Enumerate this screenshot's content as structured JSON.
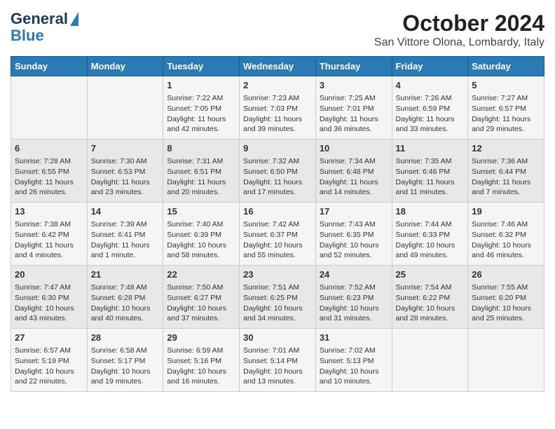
{
  "logo": {
    "line1": "General",
    "line2": "Blue"
  },
  "title": "October 2024",
  "subtitle": "San Vittore Olona, Lombardy, Italy",
  "headers": [
    "Sunday",
    "Monday",
    "Tuesday",
    "Wednesday",
    "Thursday",
    "Friday",
    "Saturday"
  ],
  "weeks": [
    [
      {
        "day": "",
        "content": ""
      },
      {
        "day": "",
        "content": ""
      },
      {
        "day": "1",
        "content": "Sunrise: 7:22 AM\nSunset: 7:05 PM\nDaylight: 11 hours and 42 minutes."
      },
      {
        "day": "2",
        "content": "Sunrise: 7:23 AM\nSunset: 7:03 PM\nDaylight: 11 hours and 39 minutes."
      },
      {
        "day": "3",
        "content": "Sunrise: 7:25 AM\nSunset: 7:01 PM\nDaylight: 11 hours and 36 minutes."
      },
      {
        "day": "4",
        "content": "Sunrise: 7:26 AM\nSunset: 6:59 PM\nDaylight: 11 hours and 33 minutes."
      },
      {
        "day": "5",
        "content": "Sunrise: 7:27 AM\nSunset: 6:57 PM\nDaylight: 11 hours and 29 minutes."
      }
    ],
    [
      {
        "day": "6",
        "content": "Sunrise: 7:28 AM\nSunset: 6:55 PM\nDaylight: 11 hours and 26 minutes."
      },
      {
        "day": "7",
        "content": "Sunrise: 7:30 AM\nSunset: 6:53 PM\nDaylight: 11 hours and 23 minutes."
      },
      {
        "day": "8",
        "content": "Sunrise: 7:31 AM\nSunset: 6:51 PM\nDaylight: 11 hours and 20 minutes."
      },
      {
        "day": "9",
        "content": "Sunrise: 7:32 AM\nSunset: 6:50 PM\nDaylight: 11 hours and 17 minutes."
      },
      {
        "day": "10",
        "content": "Sunrise: 7:34 AM\nSunset: 6:48 PM\nDaylight: 11 hours and 14 minutes."
      },
      {
        "day": "11",
        "content": "Sunrise: 7:35 AM\nSunset: 6:46 PM\nDaylight: 11 hours and 11 minutes."
      },
      {
        "day": "12",
        "content": "Sunrise: 7:36 AM\nSunset: 6:44 PM\nDaylight: 11 hours and 7 minutes."
      }
    ],
    [
      {
        "day": "13",
        "content": "Sunrise: 7:38 AM\nSunset: 6:42 PM\nDaylight: 11 hours and 4 minutes."
      },
      {
        "day": "14",
        "content": "Sunrise: 7:39 AM\nSunset: 6:41 PM\nDaylight: 11 hours and 1 minute."
      },
      {
        "day": "15",
        "content": "Sunrise: 7:40 AM\nSunset: 6:39 PM\nDaylight: 10 hours and 58 minutes."
      },
      {
        "day": "16",
        "content": "Sunrise: 7:42 AM\nSunset: 6:37 PM\nDaylight: 10 hours and 55 minutes."
      },
      {
        "day": "17",
        "content": "Sunrise: 7:43 AM\nSunset: 6:35 PM\nDaylight: 10 hours and 52 minutes."
      },
      {
        "day": "18",
        "content": "Sunrise: 7:44 AM\nSunset: 6:33 PM\nDaylight: 10 hours and 49 minutes."
      },
      {
        "day": "19",
        "content": "Sunrise: 7:46 AM\nSunset: 6:32 PM\nDaylight: 10 hours and 46 minutes."
      }
    ],
    [
      {
        "day": "20",
        "content": "Sunrise: 7:47 AM\nSunset: 6:30 PM\nDaylight: 10 hours and 43 minutes."
      },
      {
        "day": "21",
        "content": "Sunrise: 7:48 AM\nSunset: 6:28 PM\nDaylight: 10 hours and 40 minutes."
      },
      {
        "day": "22",
        "content": "Sunrise: 7:50 AM\nSunset: 6:27 PM\nDaylight: 10 hours and 37 minutes."
      },
      {
        "day": "23",
        "content": "Sunrise: 7:51 AM\nSunset: 6:25 PM\nDaylight: 10 hours and 34 minutes."
      },
      {
        "day": "24",
        "content": "Sunrise: 7:52 AM\nSunset: 6:23 PM\nDaylight: 10 hours and 31 minutes."
      },
      {
        "day": "25",
        "content": "Sunrise: 7:54 AM\nSunset: 6:22 PM\nDaylight: 10 hours and 28 minutes."
      },
      {
        "day": "26",
        "content": "Sunrise: 7:55 AM\nSunset: 6:20 PM\nDaylight: 10 hours and 25 minutes."
      }
    ],
    [
      {
        "day": "27",
        "content": "Sunrise: 6:57 AM\nSunset: 5:19 PM\nDaylight: 10 hours and 22 minutes."
      },
      {
        "day": "28",
        "content": "Sunrise: 6:58 AM\nSunset: 5:17 PM\nDaylight: 10 hours and 19 minutes."
      },
      {
        "day": "29",
        "content": "Sunrise: 6:59 AM\nSunset: 5:16 PM\nDaylight: 10 hours and 16 minutes."
      },
      {
        "day": "30",
        "content": "Sunrise: 7:01 AM\nSunset: 5:14 PM\nDaylight: 10 hours and 13 minutes."
      },
      {
        "day": "31",
        "content": "Sunrise: 7:02 AM\nSunset: 5:13 PM\nDaylight: 10 hours and 10 minutes."
      },
      {
        "day": "",
        "content": ""
      },
      {
        "day": "",
        "content": ""
      }
    ]
  ]
}
